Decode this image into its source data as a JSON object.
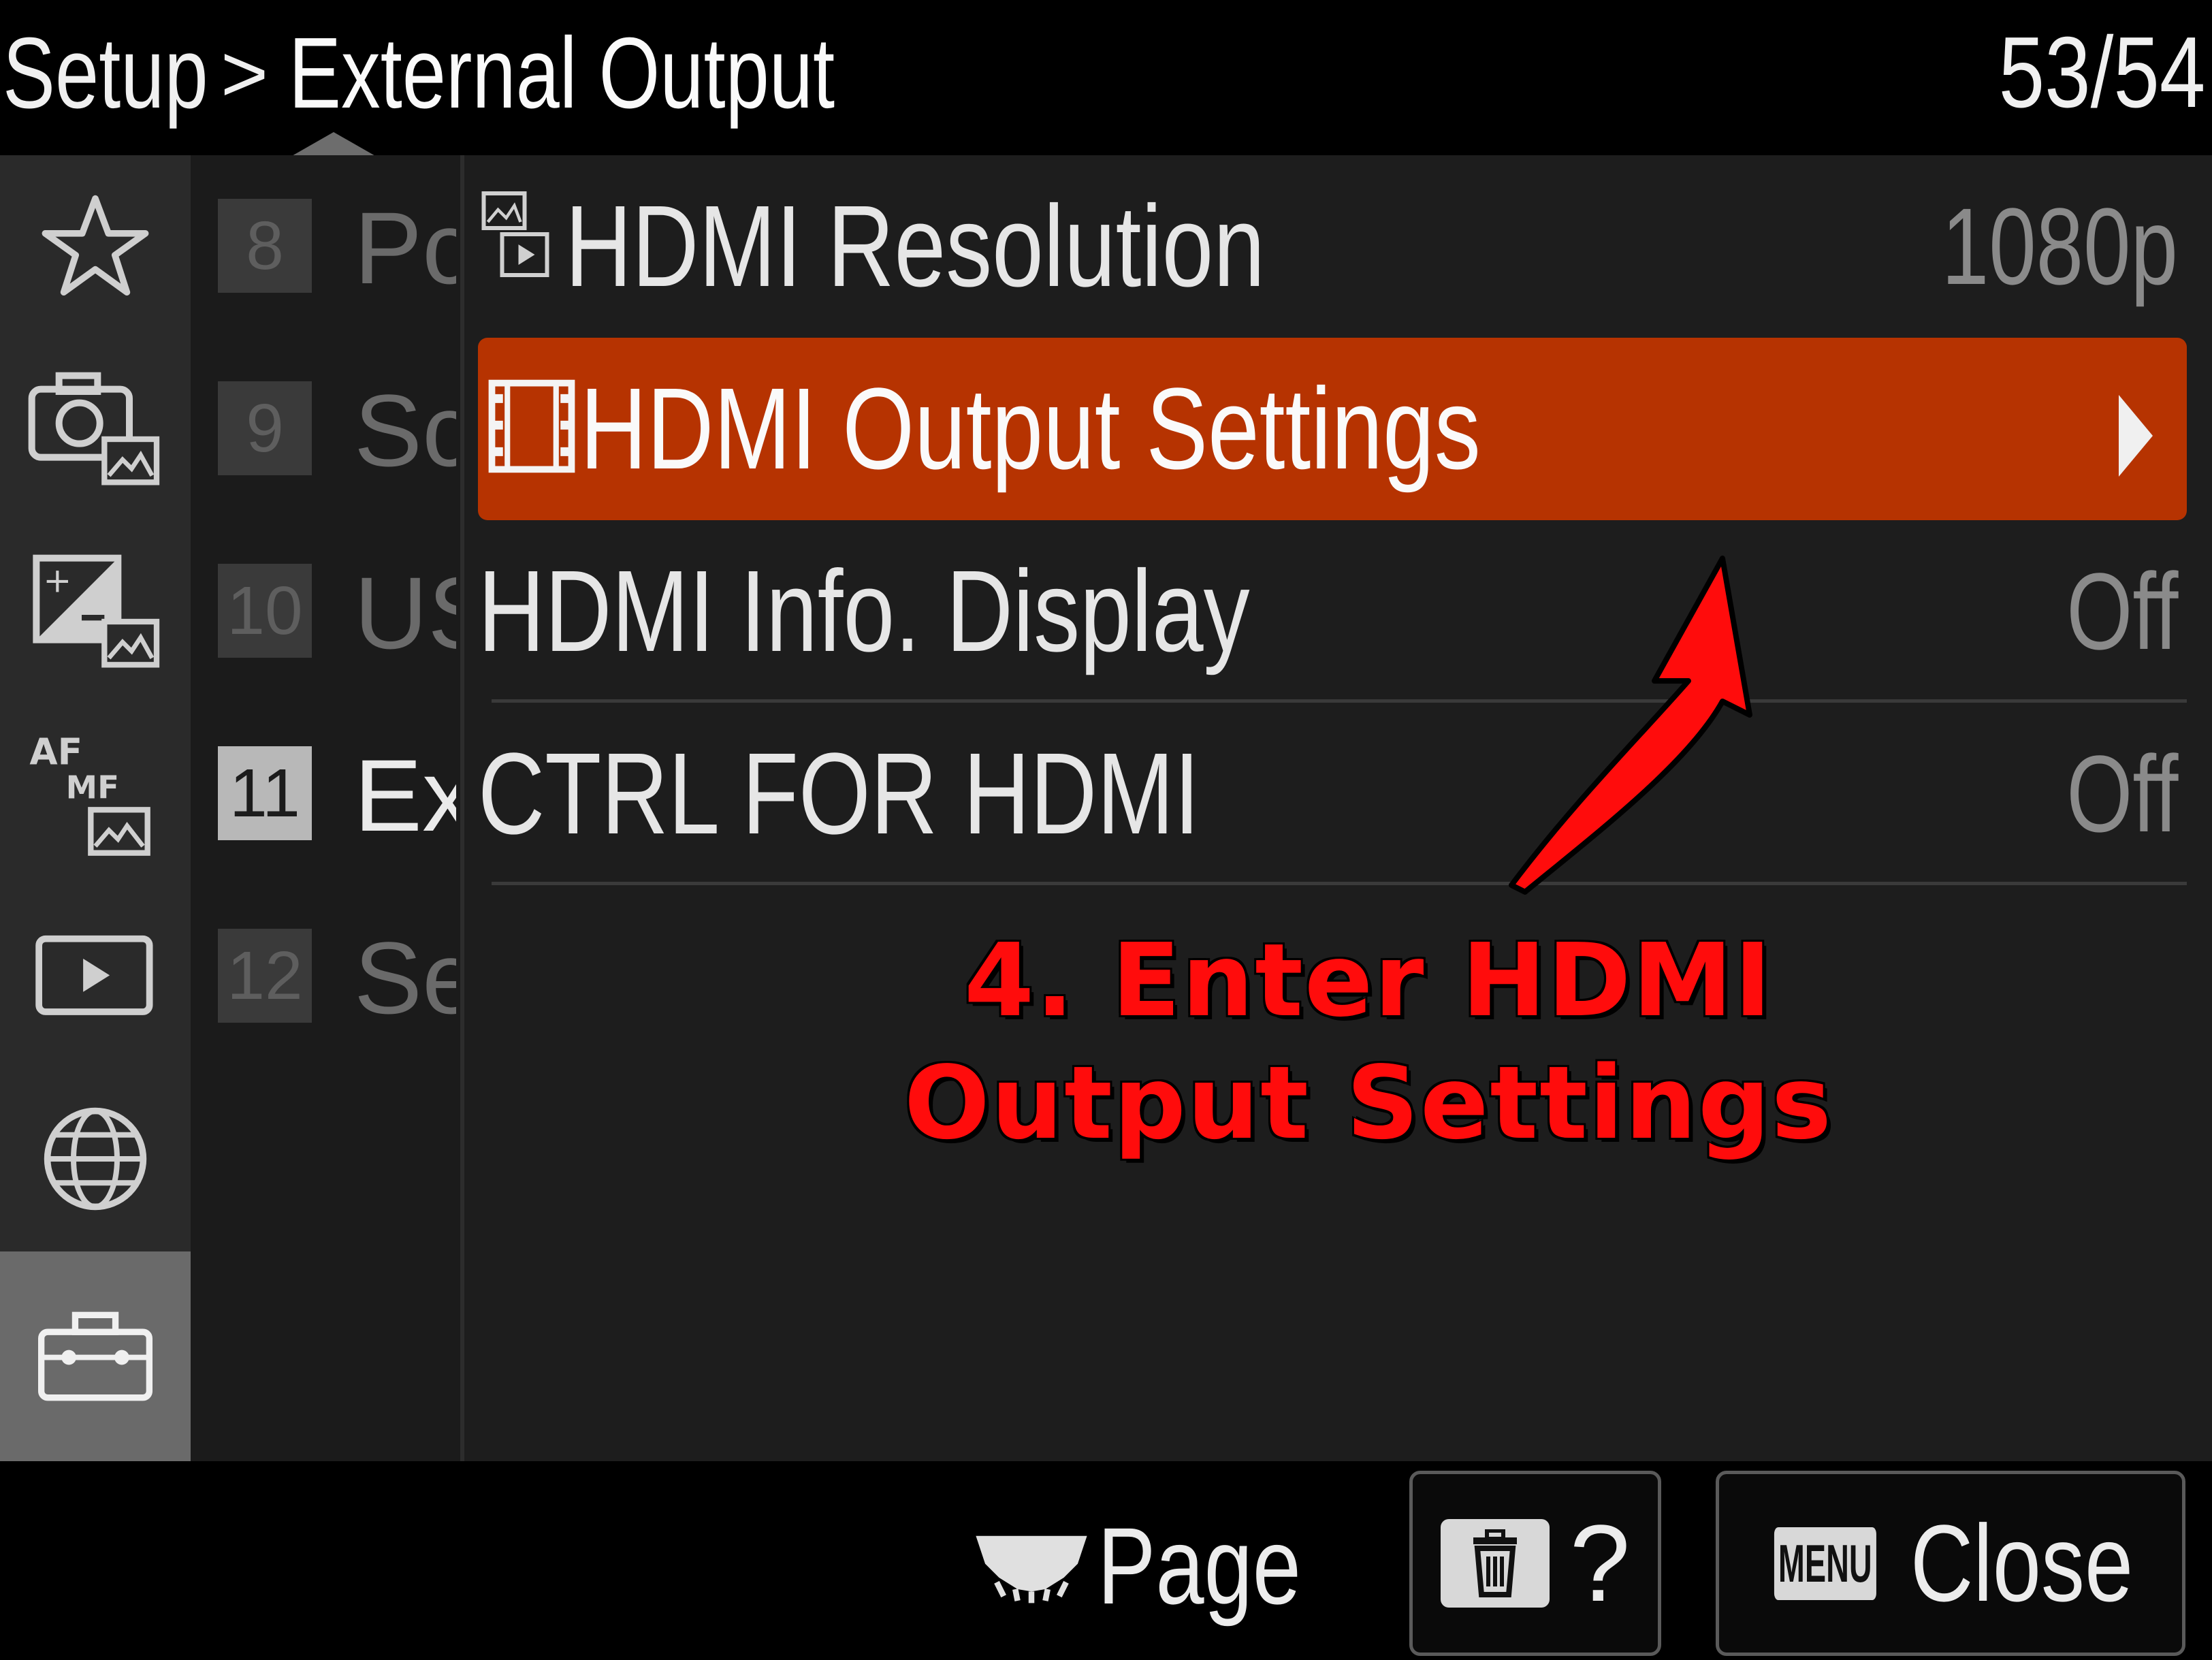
{
  "header": {
    "breadcrumb_root": "Setup",
    "breadcrumb_sep": ">",
    "breadcrumb_current": "External Output",
    "page_counter": "53/54"
  },
  "sidebar": {
    "icons": [
      "star-icon",
      "camera-photo-icon",
      "exposure-icon",
      "af-mf-icon",
      "playback-icon",
      "globe-icon",
      "toolbox-icon"
    ],
    "af_label": "AF",
    "mf_label": "MF"
  },
  "subcategories": [
    {
      "num": "8",
      "text": "Pc"
    },
    {
      "num": "9",
      "text": "Sc"
    },
    {
      "num": "10",
      "text": "US"
    },
    {
      "num": "11",
      "text": "Ex",
      "active": true
    },
    {
      "num": "12",
      "text": "Se"
    }
  ],
  "menu": {
    "items": [
      {
        "label": "HDMI Resolution",
        "value": "1080p"
      },
      {
        "label": "HDMI Output Settings",
        "value": "",
        "active": true
      },
      {
        "label": "HDMI Info. Display",
        "value": "Off"
      },
      {
        "label": "CTRL FOR HDMI",
        "value": "Off"
      }
    ]
  },
  "annotation": {
    "line1": "4. Enter HDMI",
    "line2": "Output Settings",
    "color": "#ff0c0c"
  },
  "footer": {
    "page_label": "Page",
    "help_label": "?",
    "menu_chip": "MENU",
    "close_label": "Close"
  },
  "colors": {
    "accent": "#b63301",
    "background": "#1d1d1d"
  }
}
